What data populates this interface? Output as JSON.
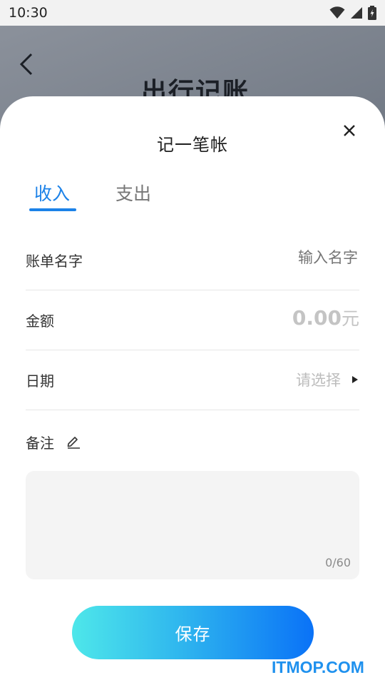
{
  "status_bar": {
    "time": "10:30"
  },
  "background_page": {
    "title": "出行记账"
  },
  "sheet": {
    "title": "记一笔帐",
    "tabs": [
      {
        "label": "收入",
        "active": true
      },
      {
        "label": "支出",
        "active": false
      }
    ],
    "fields": {
      "name": {
        "label": "账单名字",
        "placeholder": "输入名字"
      },
      "amount": {
        "label": "金额",
        "value": "0.00",
        "unit": "元"
      },
      "date": {
        "label": "日期",
        "placeholder": "请选择"
      }
    },
    "note": {
      "label": "备注",
      "counter": "0/60"
    },
    "save_label": "保存"
  },
  "watermark": "ITMOP.COM",
  "colors": {
    "accent": "#1c82e8",
    "button_gradient_start": "#4ee7ea",
    "button_gradient_end": "#0a72f7"
  }
}
